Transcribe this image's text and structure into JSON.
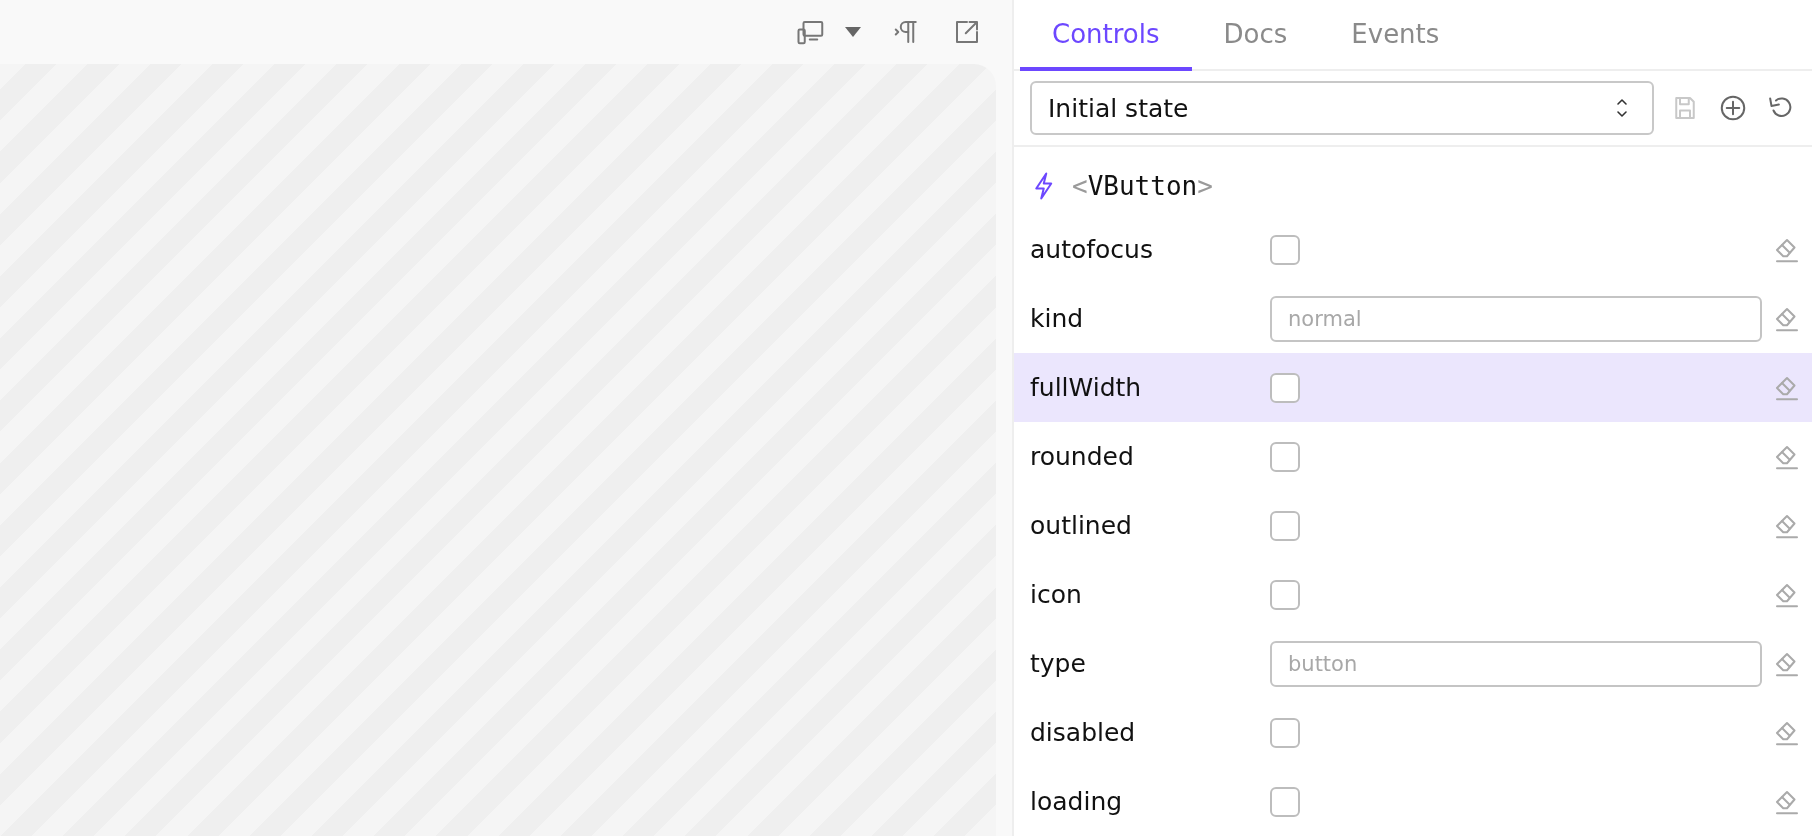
{
  "tabs": [
    {
      "label": "Controls",
      "selected": true
    },
    {
      "label": "Docs",
      "selected": false
    },
    {
      "label": "Events",
      "selected": false
    }
  ],
  "state_select": {
    "value": "Initial state"
  },
  "component": {
    "open": "<",
    "name": "VButton",
    "close": ">"
  },
  "props": [
    {
      "name": "autofocus",
      "kind": "checkbox",
      "checked": false,
      "highlighted": false
    },
    {
      "name": "kind",
      "kind": "text",
      "placeholder": "normal",
      "highlighted": false
    },
    {
      "name": "fullWidth",
      "kind": "checkbox",
      "checked": false,
      "highlighted": true
    },
    {
      "name": "rounded",
      "kind": "checkbox",
      "checked": false,
      "highlighted": false
    },
    {
      "name": "outlined",
      "kind": "checkbox",
      "checked": false,
      "highlighted": false
    },
    {
      "name": "icon",
      "kind": "checkbox",
      "checked": false,
      "highlighted": false
    },
    {
      "name": "type",
      "kind": "text",
      "placeholder": "button",
      "highlighted": false
    },
    {
      "name": "disabled",
      "kind": "checkbox",
      "checked": false,
      "highlighted": false
    },
    {
      "name": "loading",
      "kind": "checkbox",
      "checked": false,
      "highlighted": false
    }
  ]
}
